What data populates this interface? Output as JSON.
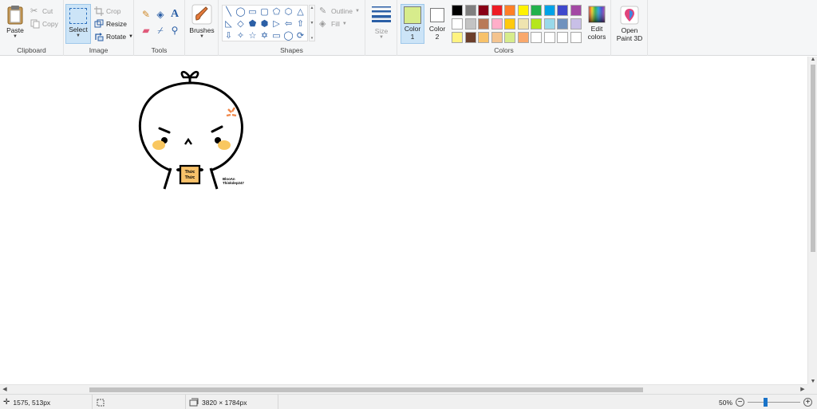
{
  "ribbon": {
    "clipboard": {
      "label": "Clipboard",
      "paste": "Paste",
      "cut": "Cut",
      "copy": "Copy"
    },
    "image": {
      "label": "Image",
      "select": "Select",
      "crop": "Crop",
      "resize": "Resize",
      "rotate": "Rotate"
    },
    "tools": {
      "label": "Tools"
    },
    "brushes": {
      "label": "Brushes"
    },
    "shapes": {
      "label": "Shapes",
      "outline": "Outline",
      "fill": "Fill",
      "glyphs": [
        "╲",
        "◯",
        "▭",
        "▢",
        "⬠",
        "⬡",
        "△",
        "◺",
        "◇",
        "⬟",
        "⬢",
        "▷",
        "⇦",
        "⇧",
        "⇩",
        "✧",
        "☆",
        "✡",
        "▭",
        "◯",
        "⟳"
      ]
    },
    "size": {
      "label": "Size"
    },
    "color1": {
      "label": "Color",
      "sub": "1",
      "value": "#d7ec8c"
    },
    "color2": {
      "label": "Color",
      "sub": "2",
      "value": "#ffffff"
    },
    "colors": {
      "label": "Colors",
      "row1": [
        "#000000",
        "#7f7f7f",
        "#880015",
        "#ed1c24",
        "#ff7f27",
        "#fff200",
        "#22b14c",
        "#00a2e8",
        "#3f48cc",
        "#a349a4"
      ],
      "row2": [
        "#ffffff",
        "#c3c3c3",
        "#b97a57",
        "#ffaec9",
        "#ffc90e",
        "#efe4b0",
        "#b5e61d",
        "#99d9ea",
        "#7092be",
        "#c8bfe7"
      ],
      "row3": [
        "#fff381",
        "#6b3e2b",
        "#f8c26a",
        "#f4c48f",
        "#d7ec8c",
        "#f9a86c",
        "#ffffff",
        "#ffffff",
        "#ffffff",
        "#ffffff"
      ]
    },
    "edit_colors": {
      "line1": "Edit",
      "line2": "colors"
    },
    "paint3d": {
      "line1": "Open",
      "line2": "Paint 3D"
    }
  },
  "drawing": {
    "sign_text": [
      "Thức",
      "Thức"
    ],
    "signature": [
      "BlooAn",
      "Thinkdep247"
    ]
  },
  "status": {
    "cursor": "1575, 513px",
    "dimensions": "3820 × 1784px",
    "zoom": "50%"
  }
}
